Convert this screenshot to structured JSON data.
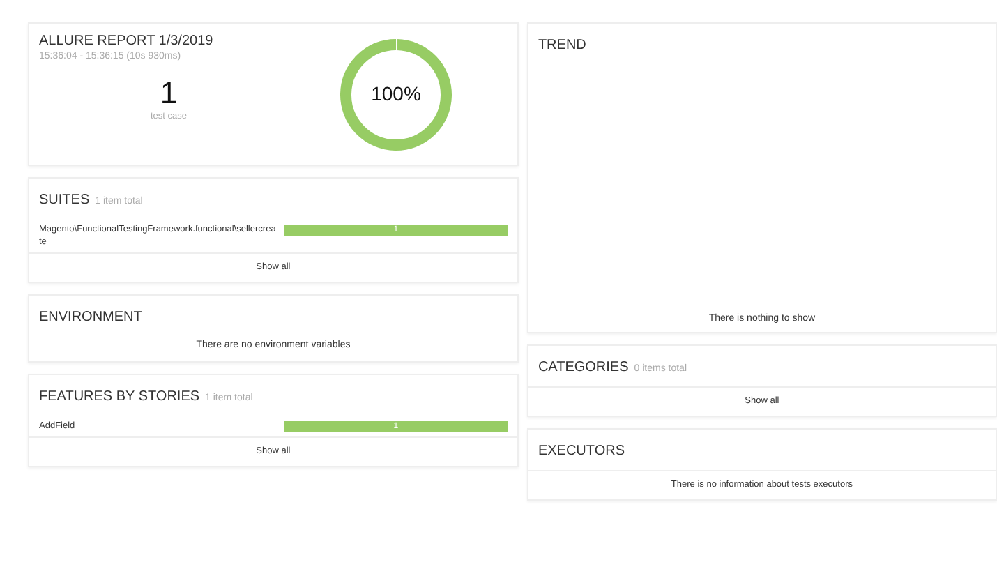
{
  "summary": {
    "title": "ALLURE REPORT 1/3/2019",
    "time": "15:36:04 - 15:36:15 (10s 930ms)",
    "count": "1",
    "count_label": "test case",
    "percent": "100%"
  },
  "suites": {
    "title": "SUITES",
    "total": "1 item total",
    "items": [
      {
        "name": "Magento\\FunctionalTestingFramework.functional\\sellercreate",
        "count": "1",
        "level": 1
      }
    ],
    "show_all": "Show all"
  },
  "environment": {
    "title": "ENVIRONMENT",
    "message": "There are no environment variables"
  },
  "features": {
    "title": "FEATURES BY STORIES",
    "total": "1 item total",
    "items": [
      {
        "name": "AddField",
        "count": "1",
        "level": 1
      }
    ],
    "show_all": "Show all"
  },
  "trend": {
    "title": "TREND",
    "message": "There is nothing to show"
  },
  "categories": {
    "title": "CATEGORIES",
    "total": "0 items total",
    "show_all": "Show all"
  },
  "executors": {
    "title": "EXECUTORS",
    "message": "There is no information about tests executors"
  }
}
